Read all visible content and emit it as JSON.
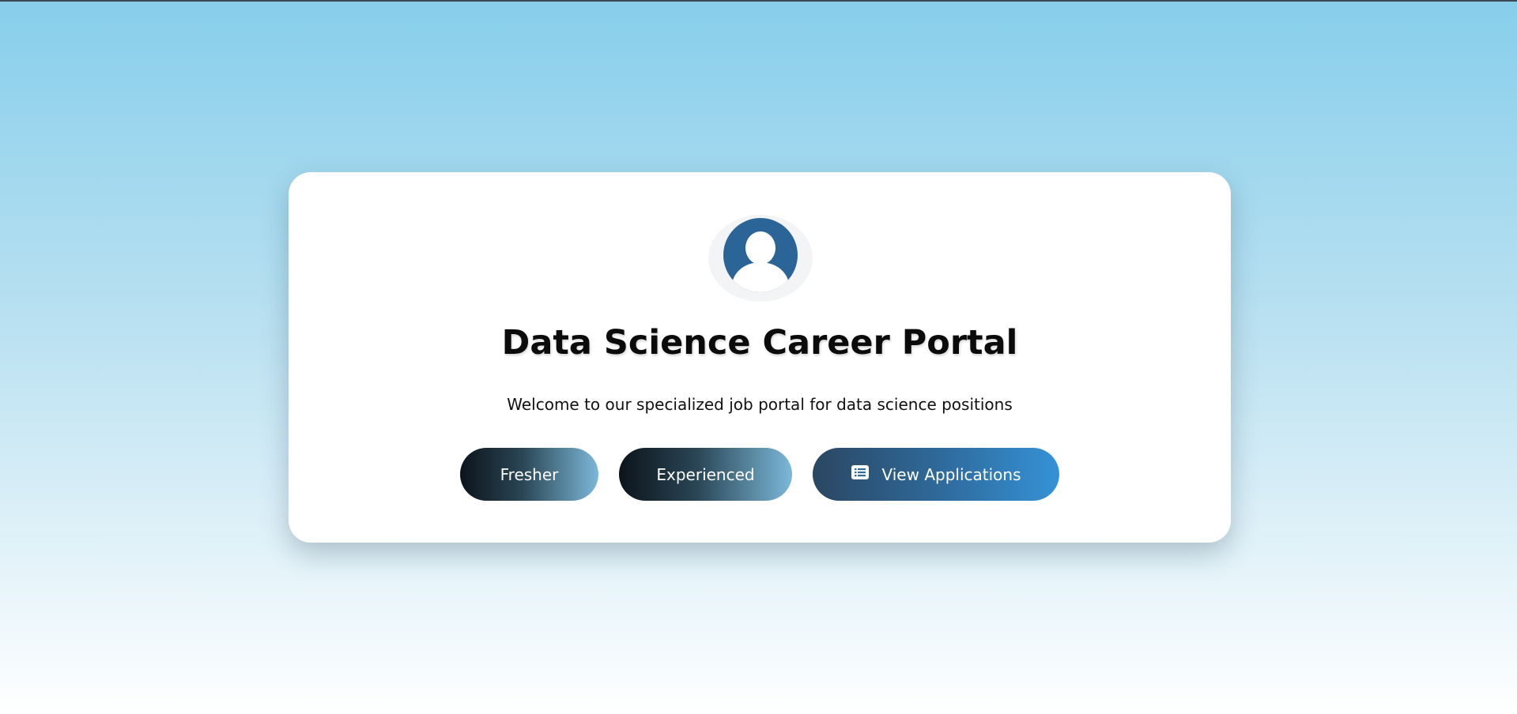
{
  "portal": {
    "title": "Data Science Career Portal",
    "subtitle": "Welcome to our specialized job portal for data science positions"
  },
  "avatar": {
    "icon": "user-avatar-icon",
    "color": "#2b6496"
  },
  "buttons": {
    "fresher_label": "Fresher",
    "experienced_label": "Experienced",
    "view_applications_label": "View Applications",
    "view_applications_icon": "list-icon"
  },
  "colors": {
    "background_top": "#87ceeb",
    "background_bottom": "#ffffff",
    "primary": "#2f6c9f",
    "accent": "#3592d6"
  }
}
